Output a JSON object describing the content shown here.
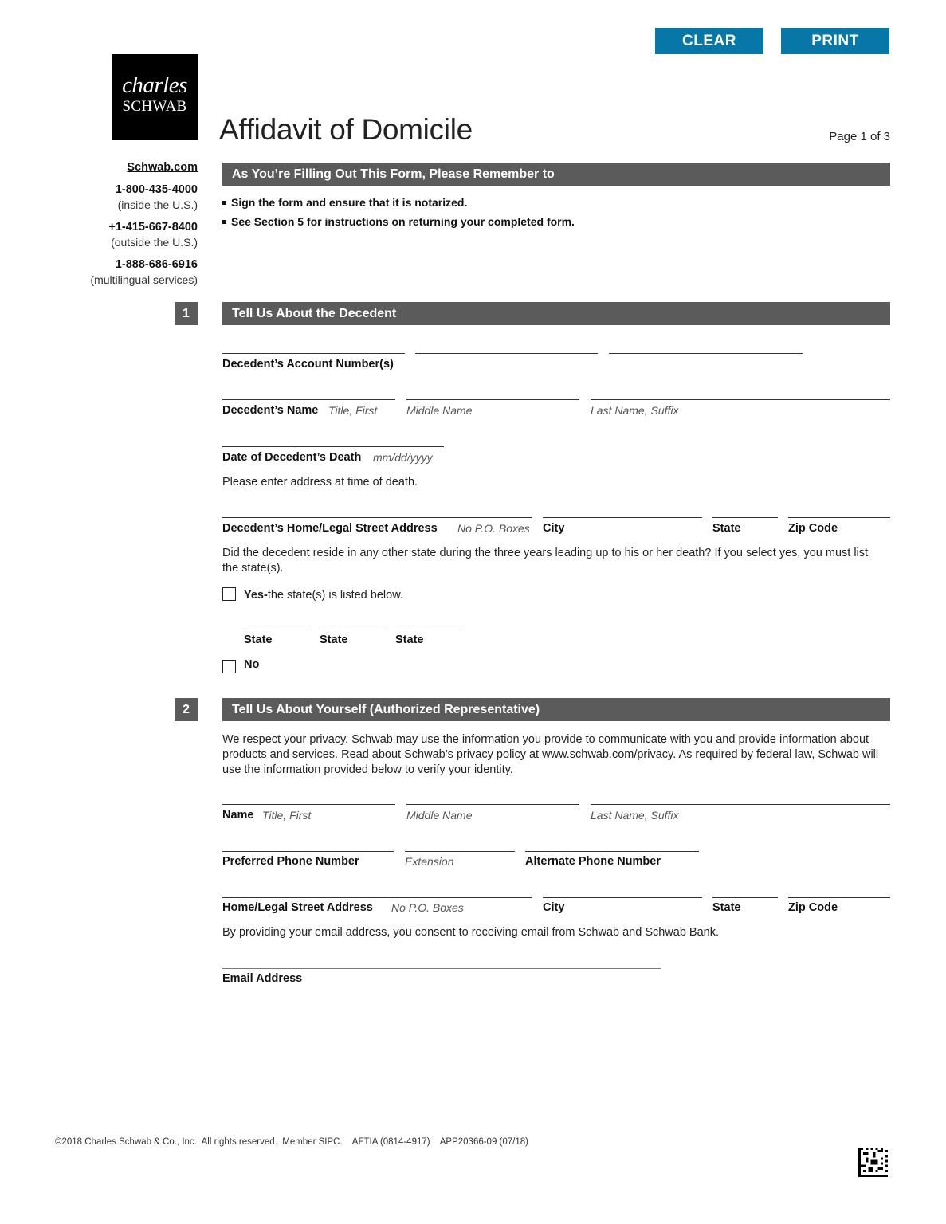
{
  "toolbar": {
    "clear_label": "CLEAR",
    "print_label": "PRINT",
    "button_color": "#0777a8"
  },
  "brand": {
    "line1": "charles",
    "line2": "SCHWAB"
  },
  "header": {
    "title": "Affidavit of Domicile",
    "page_indicator": "Page 1 of 3"
  },
  "sidebar": {
    "website": "Schwab.com",
    "contacts": [
      {
        "number": "1-800-435-4000",
        "note": "(inside the U.S.)"
      },
      {
        "number": "+1-415-667-8400",
        "note": "(outside the U.S.)"
      },
      {
        "number": "1-888-686-6916",
        "note": "(multilingual services)"
      }
    ]
  },
  "reminder": {
    "heading": "As You’re Filling Out This Form, Please Remember to",
    "bullets": [
      "Sign the form and ensure that it is notarized.",
      "See Section 5 for instructions on returning your completed form."
    ]
  },
  "section1": {
    "number": "1",
    "heading": "Tell Us About the Decedent",
    "account_label": "Decedent’s Account Number(s)",
    "name_label": "Decedent’s Name",
    "name_hint_first": "Title, First",
    "name_hint_middle": "Middle Name",
    "name_hint_last": "Last Name, Suffix",
    "death_label": "Date of Decedent’s Death",
    "death_hint": "mm/dd/yyyy",
    "address_intro": "Please enter address at time of death.",
    "address_label": "Decedent’s Home/Legal Street Address",
    "address_hint": "No P.O. Boxes",
    "city_label": "City",
    "state_label": "State",
    "zip_label": "Zip Code",
    "residency_question": "Did the decedent reside in any other state during the three years leading up to his or her death? If you select yes, you must list the state(s).",
    "yes_bold": "Yes-",
    "yes_text": "the state(s) is listed below.",
    "yes_checked": false,
    "other_states": [
      "State",
      "State",
      "State"
    ],
    "no_label": "No",
    "no_checked": false
  },
  "section2": {
    "number": "2",
    "heading": "Tell Us About Yourself (Authorized Representative)",
    "privacy_text": "We respect your privacy. Schwab may use the information you provide to communicate with you and provide information about products and services. Read about Schwab’s privacy policy at www.schwab.com/privacy. As required by federal law, Schwab will use the information provided below to verify your identity.",
    "name_label": "Name",
    "name_hint_first": "Title, First",
    "name_hint_middle": "Middle Name",
    "name_hint_last": "Last Name, Suffix",
    "phone_label": "Preferred Phone Number",
    "extension_hint": "Extension",
    "alt_phone_label": "Alternate Phone Number",
    "address_label": "Home/Legal Street Address",
    "address_hint": "No P.O. Boxes",
    "city_label": "City",
    "state_label": "State",
    "zip_label": "Zip Code",
    "email_consent": "By providing your email address, you consent to receiving email from Schwab and Schwab Bank.",
    "email_label": "Email Address"
  },
  "footer": {
    "text": "©2018 Charles Schwab & Co., Inc.  All rights reserved.  Member SIPC.    AFTIA (0814-4917)    APP20366-09 (07/18)",
    "barcode_icon": "datamatrix-barcode-icon"
  }
}
